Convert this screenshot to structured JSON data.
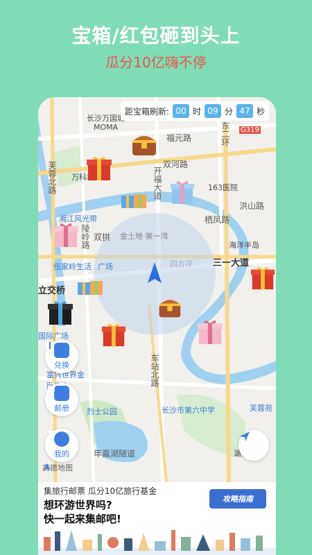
{
  "promo": {
    "title": "宝箱/红包砸到头上",
    "subtitle": "瓜分10亿嗨不停"
  },
  "countdown": {
    "label": "距宝箱刷新:",
    "hours": "00",
    "hours_unit": "时",
    "minutes": "09",
    "minutes_unit": "分",
    "seconds": "47",
    "seconds_unit": "秒"
  },
  "map": {
    "labels": {
      "wanguo": "长沙万国城",
      "moma": "MOMA",
      "fuyuan": "福元路",
      "g319": "G319",
      "shuanghe": "双河路",
      "furong": "芙蓉北路",
      "wanke": "万科城",
      "kaifu": "开福大道",
      "hospital": "163医院",
      "hongshan": "洪山路",
      "xiangjiang": "湘江风光带",
      "lingling": "陵岭路",
      "shuangpu": "双拱",
      "qixia": "栖凤路",
      "jintudi": "金土地·第一湾",
      "haiyang": "海洋半岛",
      "wujia": "伍家岭生活",
      "guangchang": "广场",
      "sihuan": "四方坪",
      "sanyi": "三一大道",
      "lijiao": "立交桥",
      "guoji": "国际广场",
      "fuxing": "富兴世界金融中心",
      "chezhan": "车站北路",
      "lieshi": "烈士公园",
      "liuzhong": "长沙市第六中学",
      "furongyuan": "芙蓉苑",
      "niansuo": "年嘉湖隧道",
      "hunan": "湖南省",
      "huan": "东二环"
    }
  },
  "buttons": {
    "exchange": "兑换",
    "album": "邮册",
    "mine": "我的"
  },
  "amap_logo": "高德地图",
  "banner": {
    "top": "集旅行邮票 瓜分10亿旅行基金",
    "line1": "想环游世界吗?",
    "line2": "快一起来集邮吧!",
    "guide": "攻略指南"
  }
}
